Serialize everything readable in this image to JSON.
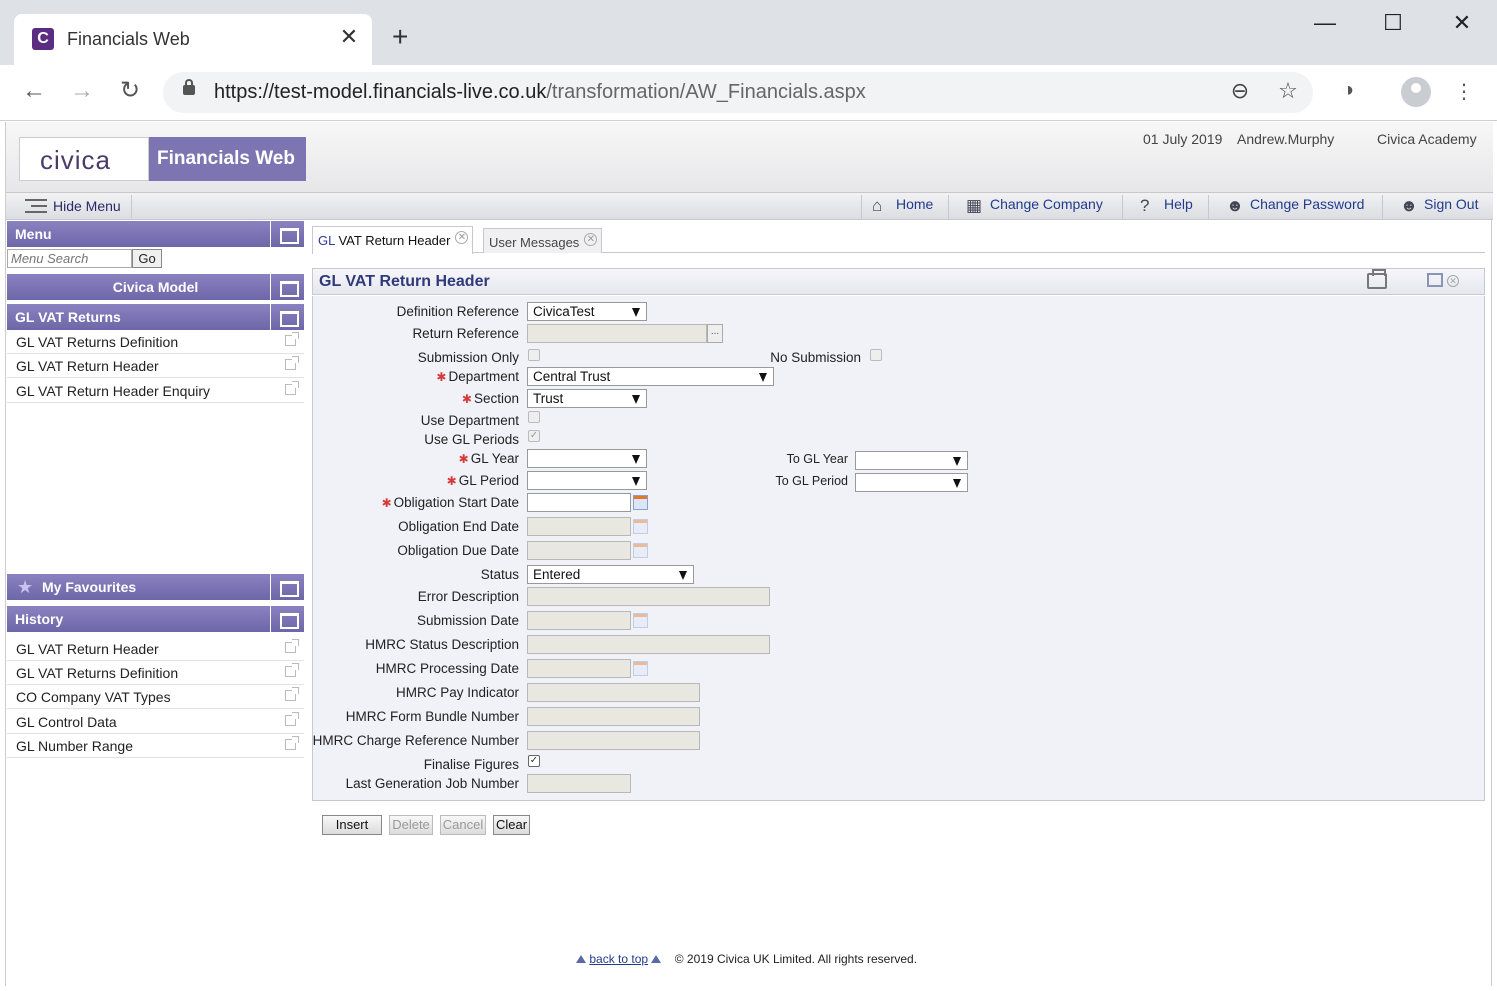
{
  "browser": {
    "tab_title": "Financials Web",
    "favicon_letter": "C",
    "url_host": "https://test-model.financials-live.co.uk",
    "url_path": "/transformation/AW_Financials.aspx"
  },
  "header": {
    "logo": "CIVICA",
    "product": "Financials Web",
    "date": "01 July 2019",
    "user": "Andrew.Murphy",
    "organisation": "Civica Academy"
  },
  "menubar": {
    "hide_menu": "Hide Menu",
    "links": [
      "Home",
      "Change Company",
      "Help",
      "Change Password",
      "Sign Out"
    ]
  },
  "sidebar": {
    "menu_title": "Menu",
    "search_placeholder": "Menu Search",
    "go": "Go",
    "model_title": "Civica Model",
    "section_title": "GL VAT Returns",
    "items": [
      "GL VAT Returns Definition",
      "GL VAT Return Header",
      "GL VAT Return Header Enquiry"
    ],
    "favourites_title": "My Favourites",
    "history_title": "History",
    "history": [
      "GL VAT Return Header",
      "GL VAT Returns Definition",
      "CO Company VAT Types",
      "GL Control Data",
      "GL Number Range"
    ]
  },
  "tabs": {
    "active_prefix": "GL",
    "active_rest": " VAT Return Header",
    "inactive": "User Messages"
  },
  "form": {
    "title": "GL VAT Return Header",
    "labels": {
      "definition_reference": "Definition Reference",
      "return_reference": "Return Reference",
      "submission_only": "Submission Only",
      "no_submission": "No Submission",
      "department": "Department",
      "section": "Section",
      "use_department": "Use Department",
      "use_gl_periods": "Use GL Periods",
      "gl_year": "GL Year",
      "to_gl_year": "To GL Year",
      "gl_period": "GL Period",
      "to_gl_period": "To GL Period",
      "obligation_start_date": "Obligation Start Date",
      "obligation_end_date": "Obligation End Date",
      "obligation_due_date": "Obligation Due Date",
      "status": "Status",
      "error_description": "Error Description",
      "submission_date": "Submission Date",
      "hmrc_status_description": "HMRC Status Description",
      "hmrc_processing_date": "HMRC Processing Date",
      "hmrc_pay_indicator": "HMRC Pay Indicator",
      "hmrc_form_bundle_number": "HMRC Form Bundle Number",
      "hmrc_charge_reference_number": "HMRC Charge Reference Number",
      "finalise_figures": "Finalise Figures",
      "last_generation_job_number": "Last Generation Job Number"
    },
    "values": {
      "definition_reference": "CivicaTest",
      "department": "Central Trust",
      "section": "Trust",
      "status": "Entered"
    },
    "checks": {
      "submission_only": false,
      "no_submission": false,
      "use_department": false,
      "use_gl_periods": true,
      "finalise_figures": true
    }
  },
  "buttons": {
    "insert": "Insert",
    "delete": "Delete",
    "cancel": "Cancel",
    "clear": "Clear"
  },
  "footer": {
    "back_to_top": "back to top",
    "copyright": "© 2019 Civica UK Limited. All rights reserved."
  }
}
